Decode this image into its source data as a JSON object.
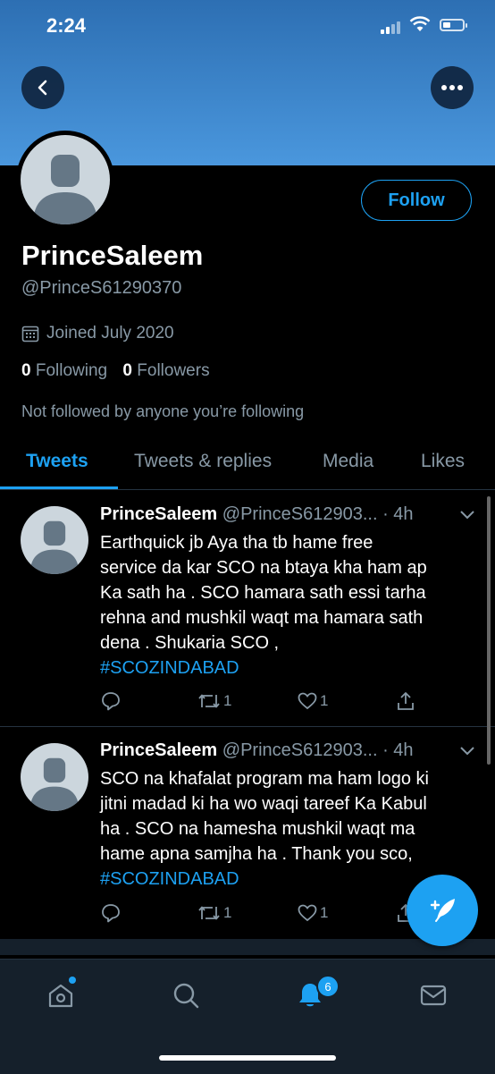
{
  "status_bar": {
    "time": "2:24"
  },
  "profile": {
    "name": "PrinceSaleem",
    "handle": "@PrinceS61290370",
    "joined": "Joined July 2020",
    "following_count": "0",
    "following_label": "Following",
    "followers_count": "0",
    "followers_label": "Followers",
    "not_followed_text": "Not followed by anyone you’re following",
    "follow_label": "Follow"
  },
  "tabs": [
    {
      "label": "Tweets",
      "active": true
    },
    {
      "label": "Tweets & replies",
      "active": false
    },
    {
      "label": "Media",
      "active": false
    },
    {
      "label": "Likes",
      "active": false
    }
  ],
  "tweets": [
    {
      "name": "PrinceSaleem",
      "handle": "@PrinceS612903...",
      "time": "· 4h",
      "lines": [
        "Earthquick jb Aya tha tb hame free",
        "service da kar SCO na btaya kha ham ap",
        "Ka sath ha . SCO hamara sath essi tarha",
        "rehna and mushkil waqt ma hamara sath",
        "dena . Shukaria SCO ,"
      ],
      "hashtag": "#SCOZINDABAD",
      "retweets": "1",
      "likes": "1"
    },
    {
      "name": "PrinceSaleem",
      "handle": "@PrinceS612903...",
      "time": "· 4h",
      "lines": [
        "SCO na khafalat program ma ham logo ki",
        "jitni madad ki ha wo waqi tareef Ka Kabul",
        "ha . SCO na hamesha mushkil waqt ma",
        "hame apna samjha ha . Thank you sco,"
      ],
      "hashtag": "#SCOZINDABAD",
      "retweets": "1",
      "likes": "1"
    }
  ],
  "nav": {
    "notification_count": "6"
  },
  "colors": {
    "accent": "#1da1f2",
    "banner": "#4a97dd",
    "background": "#000000",
    "secondary_text": "#8899a6",
    "nav_bg": "#15202b"
  },
  "icons": [
    "back-arrow-icon",
    "more-options-icon",
    "calendar-icon",
    "chevron-down-icon",
    "reply-icon",
    "retweet-icon",
    "heart-icon",
    "share-icon",
    "compose-tweet-icon",
    "home-icon",
    "search-icon",
    "notifications-icon",
    "messages-icon"
  ]
}
